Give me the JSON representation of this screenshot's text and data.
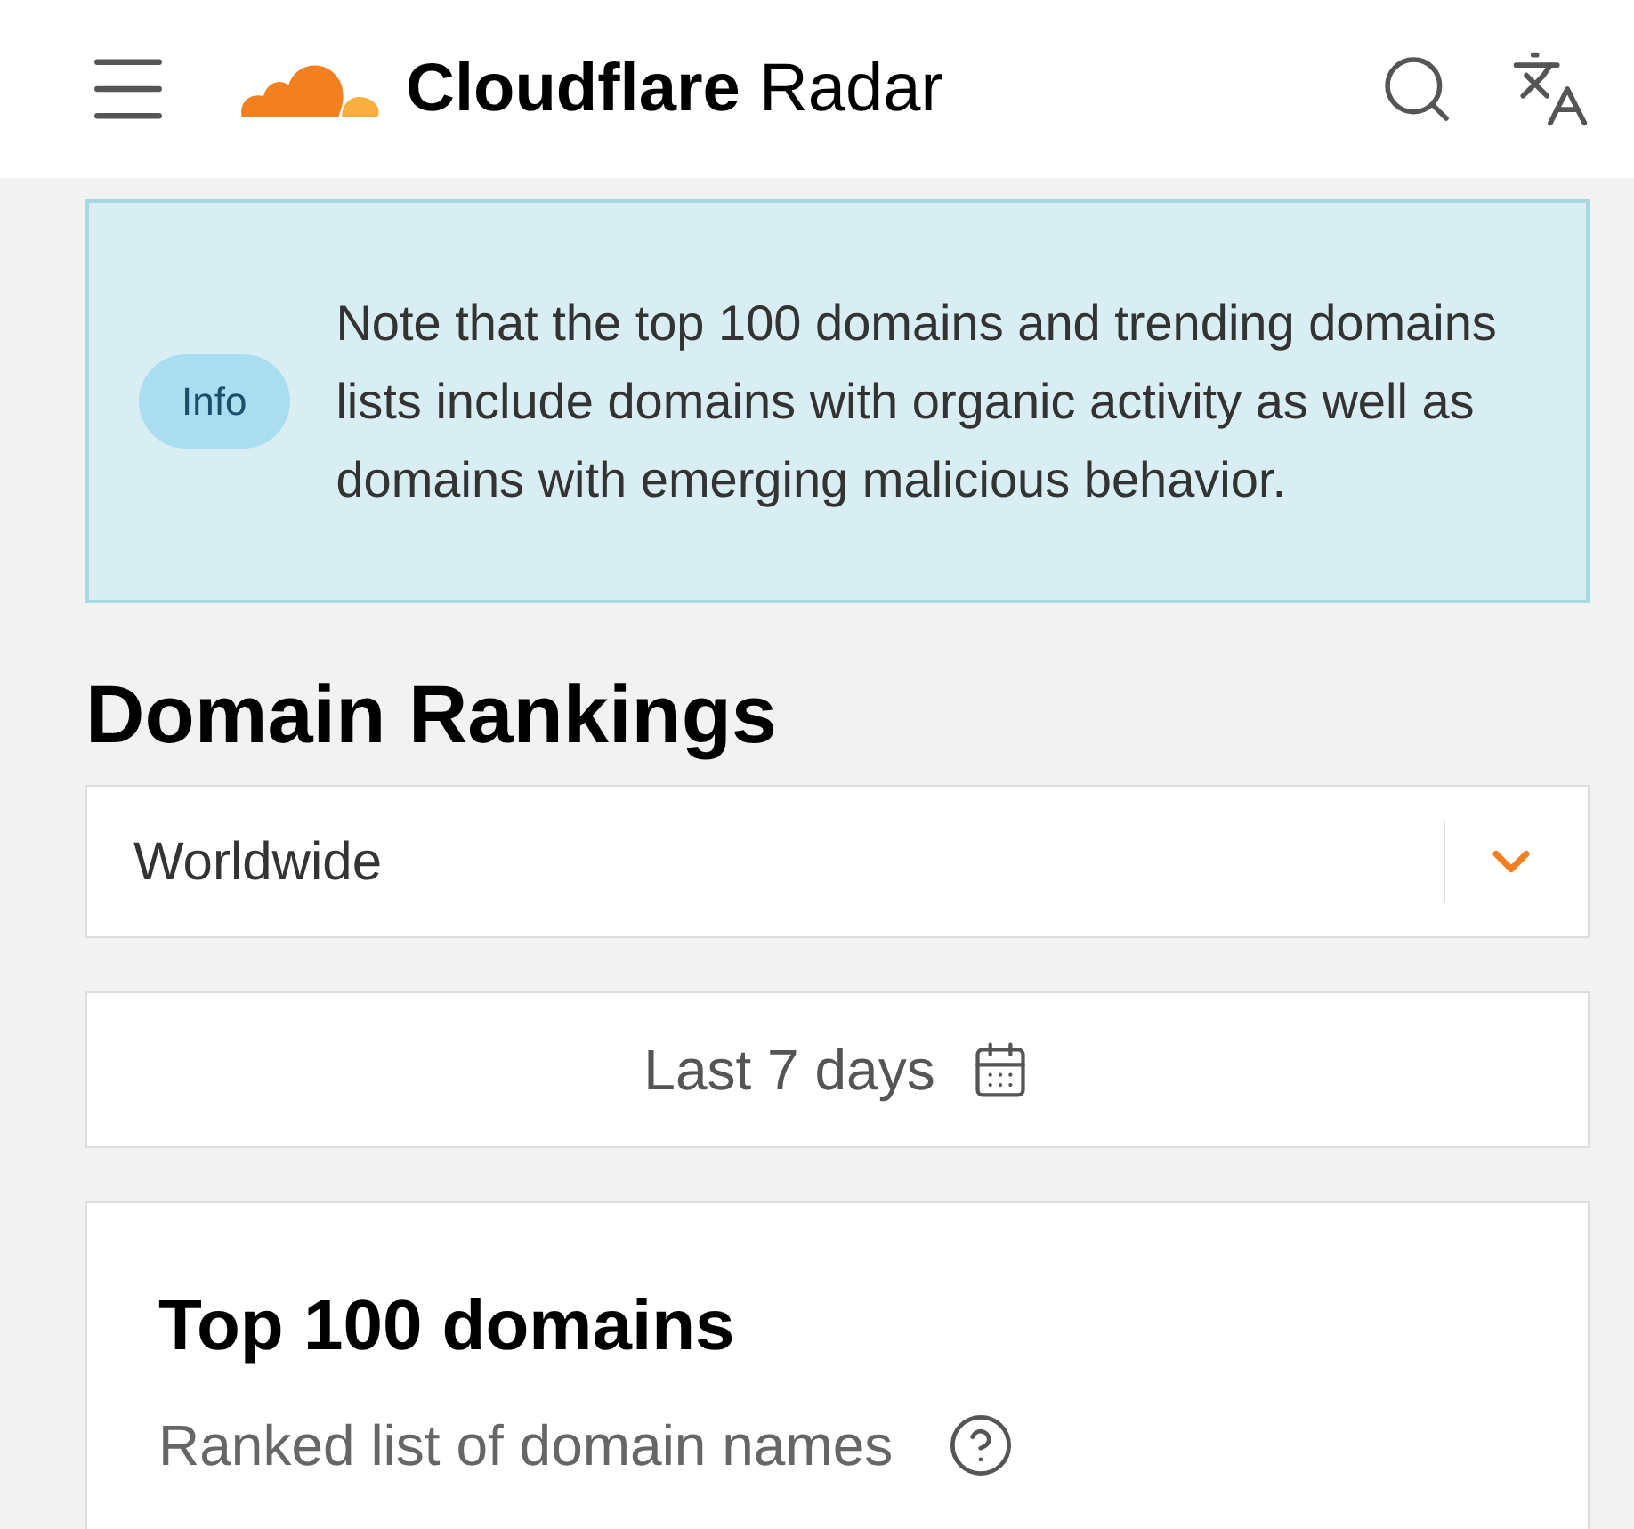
{
  "header": {
    "title": "**Cloudflare** Radar"
  },
  "info": {
    "badge": "Info",
    "text": "Note that the top 100 domains and trending domains lists include domains with organic activity as well as domains with emerging malicious behavior."
  },
  "heading": "Domain Rankings",
  "location_select": {
    "value": "Worldwide"
  },
  "date_range": {
    "label": "Last 7 days"
  },
  "card": {
    "title": "Top 100 domains",
    "subtitle": "Ranked list of domain names"
  }
}
